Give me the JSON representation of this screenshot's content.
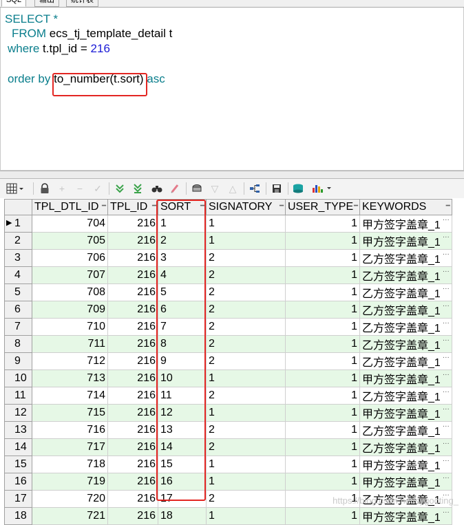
{
  "tabs": [
    "SQL",
    "输出",
    "统计表"
  ],
  "sql": {
    "line1": "SELECT *",
    "line2_kw": "FROM",
    "line2_rest": "ecs_tj_template_detail t",
    "line3_kw": "where",
    "line3_rest": "t.tpl_id =",
    "line3_num": "216",
    "line4_kw": "order by",
    "line4_fn": "to_number(t.sort)",
    "line4_tail": "asc"
  },
  "grid": {
    "columns": [
      "TPL_DTL_ID",
      "TPL_ID",
      "SORT",
      "SIGNATORY",
      "USER_TYPE",
      "KEYWORDS"
    ],
    "rows": [
      {
        "n": "1",
        "id": "704",
        "tpl": "216",
        "sort": "1",
        "sig": "1",
        "ut": "1",
        "kw": "甲方签字盖章_1"
      },
      {
        "n": "2",
        "id": "705",
        "tpl": "216",
        "sort": "2",
        "sig": "1",
        "ut": "1",
        "kw": "甲方签字盖章_1"
      },
      {
        "n": "3",
        "id": "706",
        "tpl": "216",
        "sort": "3",
        "sig": "2",
        "ut": "1",
        "kw": "乙方签字盖章_1"
      },
      {
        "n": "4",
        "id": "707",
        "tpl": "216",
        "sort": "4",
        "sig": "2",
        "ut": "1",
        "kw": "乙方签字盖章_1"
      },
      {
        "n": "5",
        "id": "708",
        "tpl": "216",
        "sort": "5",
        "sig": "2",
        "ut": "1",
        "kw": "乙方签字盖章_1"
      },
      {
        "n": "6",
        "id": "709",
        "tpl": "216",
        "sort": "6",
        "sig": "2",
        "ut": "1",
        "kw": "乙方签字盖章_1"
      },
      {
        "n": "7",
        "id": "710",
        "tpl": "216",
        "sort": "7",
        "sig": "2",
        "ut": "1",
        "kw": "乙方签字盖章_1"
      },
      {
        "n": "8",
        "id": "711",
        "tpl": "216",
        "sort": "8",
        "sig": "2",
        "ut": "1",
        "kw": "乙方签字盖章_1"
      },
      {
        "n": "9",
        "id": "712",
        "tpl": "216",
        "sort": "9",
        "sig": "2",
        "ut": "1",
        "kw": "乙方签字盖章_1"
      },
      {
        "n": "10",
        "id": "713",
        "tpl": "216",
        "sort": "10",
        "sig": "1",
        "ut": "1",
        "kw": "甲方签字盖章_1"
      },
      {
        "n": "11",
        "id": "714",
        "tpl": "216",
        "sort": "11",
        "sig": "2",
        "ut": "1",
        "kw": "乙方签字盖章_1"
      },
      {
        "n": "12",
        "id": "715",
        "tpl": "216",
        "sort": "12",
        "sig": "1",
        "ut": "1",
        "kw": "甲方签字盖章_1"
      },
      {
        "n": "13",
        "id": "716",
        "tpl": "216",
        "sort": "13",
        "sig": "2",
        "ut": "1",
        "kw": "乙方签字盖章_1"
      },
      {
        "n": "14",
        "id": "717",
        "tpl": "216",
        "sort": "14",
        "sig": "2",
        "ut": "1",
        "kw": "乙方签字盖章_1"
      },
      {
        "n": "15",
        "id": "718",
        "tpl": "216",
        "sort": "15",
        "sig": "1",
        "ut": "1",
        "kw": "甲方签字盖章_1"
      },
      {
        "n": "16",
        "id": "719",
        "tpl": "216",
        "sort": "16",
        "sig": "1",
        "ut": "1",
        "kw": "甲方签字盖章_1"
      },
      {
        "n": "17",
        "id": "720",
        "tpl": "216",
        "sort": "17",
        "sig": "2",
        "ut": "1",
        "kw": "乙方签字盖章_1"
      },
      {
        "n": "18",
        "id": "721",
        "tpl": "216",
        "sort": "18",
        "sig": "1",
        "ut": "1",
        "kw": "甲方签字盖章_1"
      }
    ],
    "current_row_marker": "▶"
  },
  "watermark": "https://blog.csdn.net/sygooting_",
  "toolbar_icons": [
    "grid-menu-icon",
    "lock-icon",
    "add-record-icon",
    "delete-record-icon",
    "post-changes-icon",
    "next-page-icon",
    "last-page-icon",
    "find-icon",
    "clear-icon",
    "query-by-example-icon",
    "sort-desc-icon",
    "sort-asc-icon",
    "connect-icon",
    "save-icon",
    "export-icon",
    "chart-icon"
  ],
  "colors": {
    "highlight": "#e32622",
    "alt_row": "#e6f8e6",
    "keyword": "#0a7e8c",
    "number": "#1a1ad6"
  }
}
